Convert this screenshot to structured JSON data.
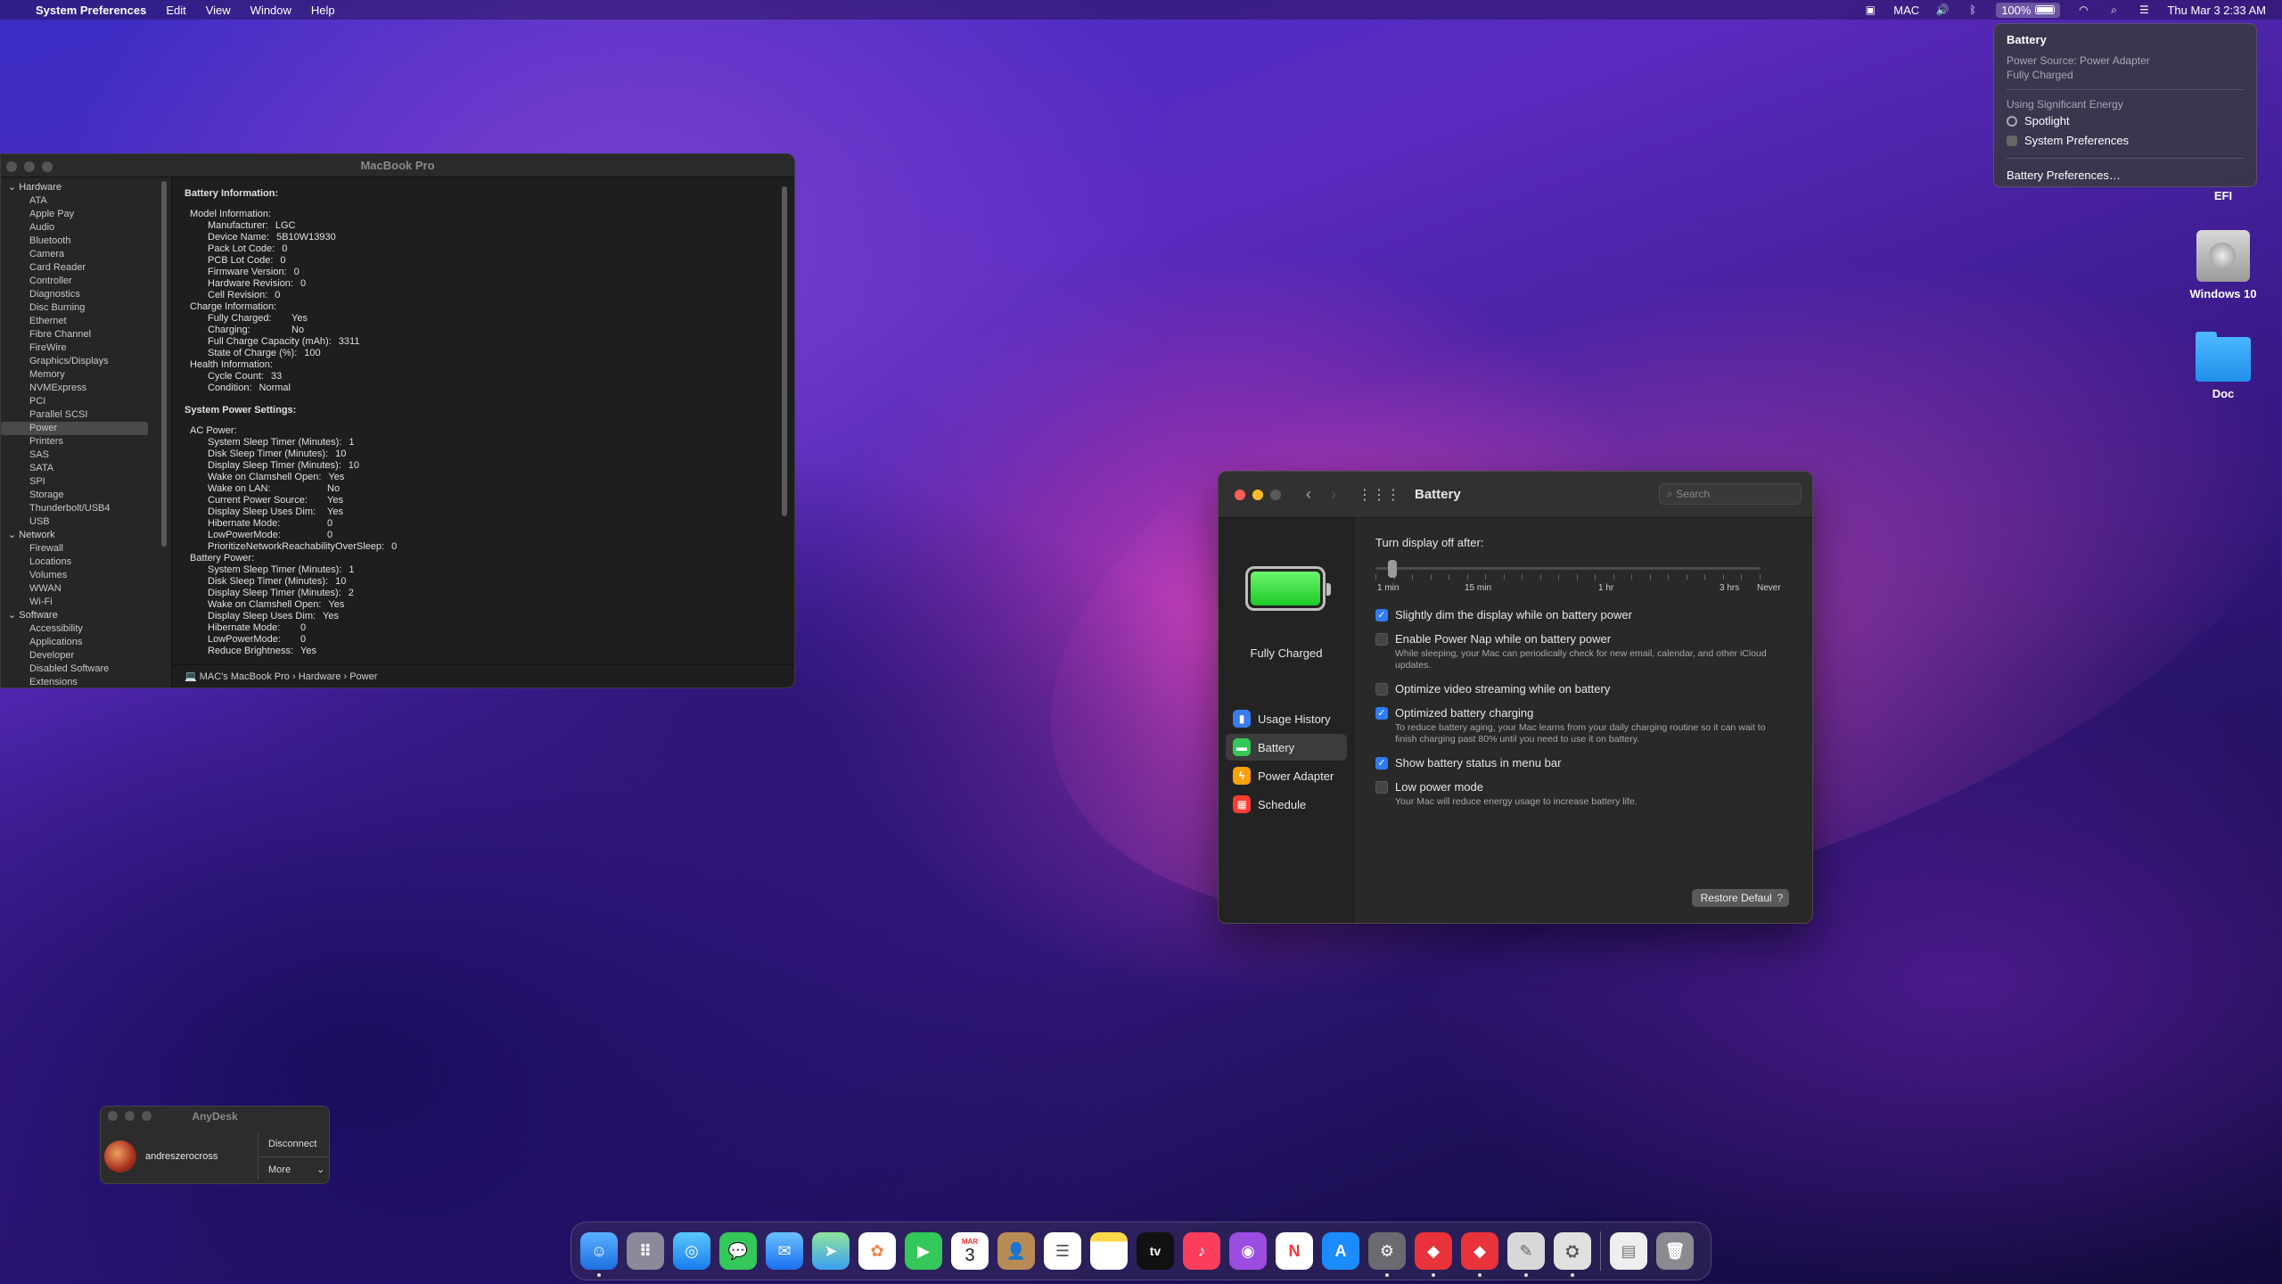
{
  "menubar": {
    "apple": "",
    "app_name": "System Preferences",
    "menus": [
      "Edit",
      "View",
      "Window",
      "Help"
    ],
    "user": "MAC",
    "battery_percent": "100%",
    "datetime": "Thu Mar 3  2:33 AM"
  },
  "battery_menu": {
    "title": "Battery",
    "power_source": "Power Source: Power Adapter",
    "status": "Fully Charged",
    "energy_header": "Using Significant Energy",
    "apps": [
      "Spotlight",
      "System Preferences"
    ],
    "prefs_link": "Battery Preferences…"
  },
  "desktop": {
    "efi": "EFI",
    "windows": "Windows 10",
    "doc": "Doc"
  },
  "sysinfo": {
    "title": "MacBook Pro",
    "sidebar": {
      "hardware": "Hardware",
      "hardware_items": [
        "ATA",
        "Apple Pay",
        "Audio",
        "Bluetooth",
        "Camera",
        "Card Reader",
        "Controller",
        "Diagnostics",
        "Disc Burning",
        "Ethernet",
        "Fibre Channel",
        "FireWire",
        "Graphics/Displays",
        "Memory",
        "NVMExpress",
        "PCI",
        "Parallel SCSI",
        "Power",
        "Printers",
        "SAS",
        "SATA",
        "SPI",
        "Storage",
        "Thunderbolt/USB4",
        "USB"
      ],
      "network": "Network",
      "network_items": [
        "Firewall",
        "Locations",
        "Volumes",
        "WWAN",
        "Wi-Fi"
      ],
      "software": "Software",
      "software_items": [
        "Accessibility",
        "Applications",
        "Developer",
        "Disabled Software",
        "Extensions"
      ]
    },
    "content": {
      "battery_info": "Battery Information:",
      "model_info": "Model Information:",
      "model_rows": [
        [
          "Manufacturer:",
          "LGC"
        ],
        [
          "Device Name:",
          "5B10W13930"
        ],
        [
          "Pack Lot Code:",
          "0"
        ],
        [
          "PCB Lot Code:",
          "0"
        ],
        [
          "Firmware Version:",
          "0"
        ],
        [
          "Hardware Revision:",
          "0"
        ],
        [
          "Cell Revision:",
          "0"
        ]
      ],
      "charge_info": "Charge Information:",
      "charge_rows": [
        [
          "Fully Charged:",
          "Yes"
        ],
        [
          "Charging:",
          "No"
        ],
        [
          "Full Charge Capacity (mAh):",
          "3311"
        ],
        [
          "State of Charge (%):",
          "100"
        ]
      ],
      "health_info": "Health Information:",
      "health_rows": [
        [
          "Cycle Count:",
          "33"
        ],
        [
          "Condition:",
          "Normal"
        ]
      ],
      "power_settings": "System Power Settings:",
      "ac_power": "AC Power:",
      "ac_rows": [
        [
          "System Sleep Timer (Minutes):",
          "1"
        ],
        [
          "Disk Sleep Timer (Minutes):",
          "10"
        ],
        [
          "Display Sleep Timer (Minutes):",
          "10"
        ],
        [
          "Wake on Clamshell Open:",
          "Yes"
        ],
        [
          "Wake on LAN:",
          "No"
        ],
        [
          "Current Power Source:",
          "Yes"
        ],
        [
          "Display Sleep Uses Dim:",
          "Yes"
        ],
        [
          "Hibernate Mode:",
          "0"
        ],
        [
          "LowPowerMode:",
          "0"
        ],
        [
          "PrioritizeNetworkReachabilityOverSleep:",
          "0"
        ]
      ],
      "battery_power": "Battery Power:",
      "bat_rows": [
        [
          "System Sleep Timer (Minutes):",
          "1"
        ],
        [
          "Disk Sleep Timer (Minutes):",
          "10"
        ],
        [
          "Display Sleep Timer (Minutes):",
          "2"
        ],
        [
          "Wake on Clamshell Open:",
          "Yes"
        ],
        [
          "Display Sleep Uses Dim:",
          "Yes"
        ],
        [
          "Hibernate Mode:",
          "0"
        ],
        [
          "LowPowerMode:",
          "0"
        ],
        [
          "Reduce Brightness:",
          "Yes"
        ]
      ]
    },
    "path": {
      "computer": "MAC's MacBook Pro",
      "sep": "›",
      "hardware": "Hardware",
      "power": "Power"
    }
  },
  "prefs": {
    "title": "Battery",
    "search_placeholder": "Search",
    "status": "Fully Charged",
    "charge_fraction": 1.0,
    "sidebar": [
      "Usage History",
      "Battery",
      "Power Adapter",
      "Schedule"
    ],
    "turn_off_label": "Turn display off after:",
    "slider_labels": [
      "1 min",
      "15 min",
      "1 hr",
      "3 hrs",
      "Never"
    ],
    "slider_value": "1 min",
    "options": [
      {
        "label": "Slightly dim the display while on battery power",
        "checked": true,
        "desc": ""
      },
      {
        "label": "Enable Power Nap while on battery power",
        "checked": false,
        "desc": "While sleeping, your Mac can periodically check for new email, calendar, and other iCloud updates."
      },
      {
        "label": "Optimize video streaming while on battery",
        "checked": false,
        "desc": ""
      },
      {
        "label": "Optimized battery charging",
        "checked": true,
        "desc": "To reduce battery aging, your Mac learns from your daily charging routine so it can wait to finish charging past 80% until you need to use it on battery."
      },
      {
        "label": "Show battery status in menu bar",
        "checked": true,
        "desc": ""
      },
      {
        "label": "Low power mode",
        "checked": false,
        "desc": "Your Mac will reduce energy usage to increase battery life."
      }
    ],
    "restore": "Restore Defaults",
    "help": "?"
  },
  "anydesk": {
    "title": "AnyDesk",
    "user": "andreszerocross",
    "disconnect": "Disconnect",
    "more": "More"
  },
  "dock": {
    "calendar_month": "MAR",
    "calendar_day": "3"
  }
}
